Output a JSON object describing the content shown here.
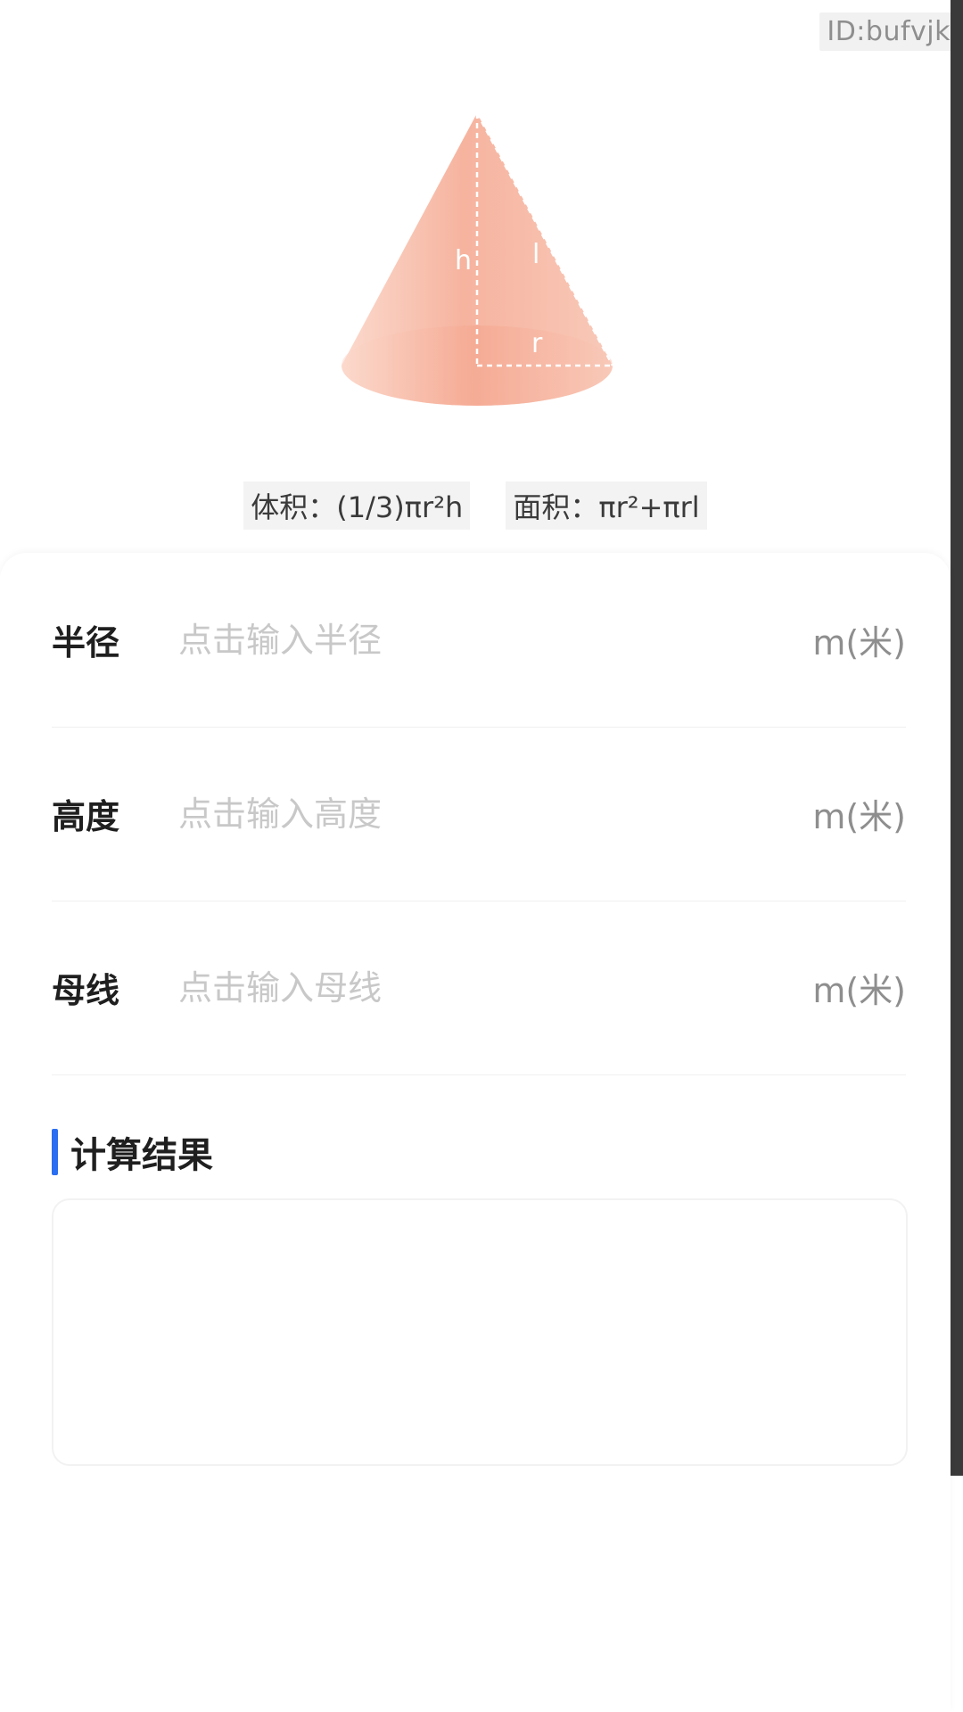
{
  "id_tag": "ID:bufvjk",
  "figure": {
    "label_h": "h",
    "label_l": "l",
    "label_r": "r"
  },
  "formulas": {
    "volume": "体积：(1/3)πr²h",
    "area": "面积：πr²+πrl"
  },
  "fields": [
    {
      "label": "半径",
      "placeholder": "点击输入半径",
      "value": "",
      "unit": "m(米)"
    },
    {
      "label": "高度",
      "placeholder": "点击输入高度",
      "value": "",
      "unit": "m(米)"
    },
    {
      "label": "母线",
      "placeholder": "点击输入母线",
      "value": "",
      "unit": "m(米)"
    }
  ],
  "result": {
    "title": "计算结果",
    "text": ""
  },
  "colors": {
    "accent": "#2a6ef2",
    "cone": "#f4a48c"
  }
}
